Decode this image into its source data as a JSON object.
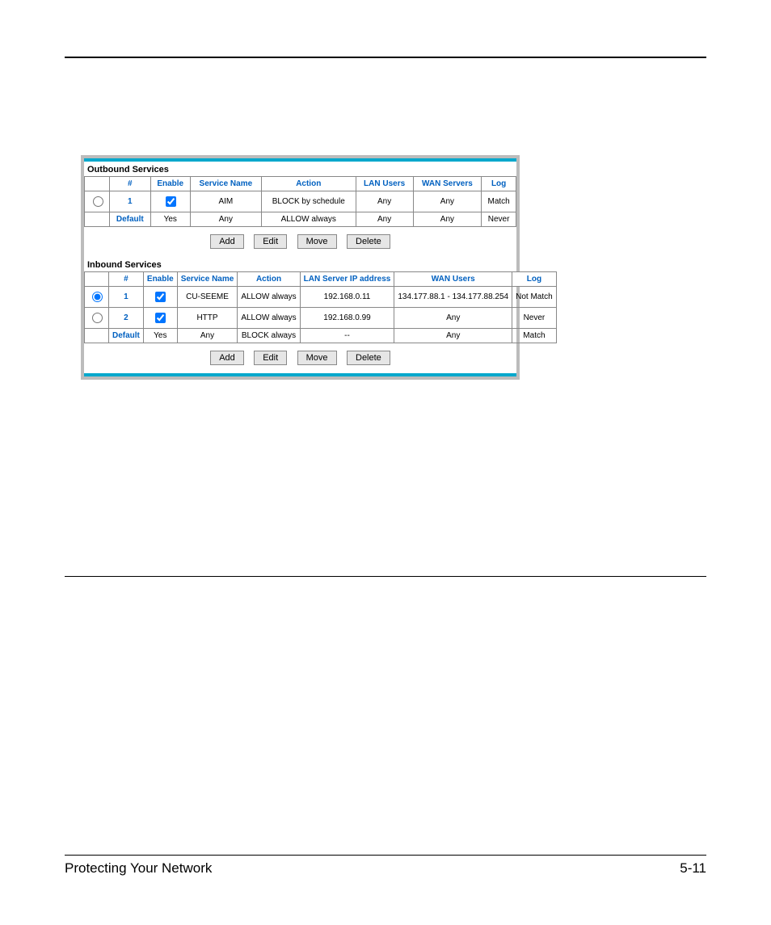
{
  "outbound": {
    "title": "Outbound Services",
    "headers": [
      "",
      "#",
      "Enable",
      "Service Name",
      "Action",
      "LAN Users",
      "WAN Servers",
      "Log"
    ],
    "rows": [
      {
        "radio": true,
        "num": "1",
        "num_link": true,
        "enable_checkbox": true,
        "enable_checked": true,
        "service": "AIM",
        "action": "BLOCK by schedule",
        "lan": "Any",
        "wan": "Any",
        "log": "Match"
      },
      {
        "radio": false,
        "num": "Default",
        "num_link": true,
        "enable_checkbox": false,
        "enable_text": "Yes",
        "service": "Any",
        "action": "ALLOW always",
        "lan": "Any",
        "wan": "Any",
        "log": "Never"
      }
    ]
  },
  "inbound": {
    "title": "Inbound Services",
    "headers": [
      "",
      "#",
      "Enable",
      "Service Name",
      "Action",
      "LAN Server IP address",
      "WAN Users",
      "Log"
    ],
    "rows": [
      {
        "radio": true,
        "radio_selected": true,
        "num": "1",
        "num_link": true,
        "enable_checkbox": true,
        "enable_checked": true,
        "service": "CU-SEEME",
        "action": "ALLOW always",
        "lan_ip": "192.168.0.11",
        "wan_users": "134.177.88.1 - 134.177.88.254",
        "log": "Not Match"
      },
      {
        "radio": true,
        "radio_selected": false,
        "num": "2",
        "num_link": true,
        "enable_checkbox": true,
        "enable_checked": true,
        "service": "HTTP",
        "action": "ALLOW always",
        "lan_ip": "192.168.0.99",
        "wan_users": "Any",
        "log": "Never"
      },
      {
        "radio": false,
        "num": "Default",
        "num_link": true,
        "enable_checkbox": false,
        "enable_text": "Yes",
        "service": "Any",
        "action": "BLOCK always",
        "lan_ip": "--",
        "wan_users": "Any",
        "log": "Match"
      }
    ]
  },
  "buttons": {
    "add": "Add",
    "edit": "Edit",
    "move": "Move",
    "delete": "Delete"
  },
  "footer": {
    "left": "Protecting Your Network",
    "right": "5-11"
  }
}
